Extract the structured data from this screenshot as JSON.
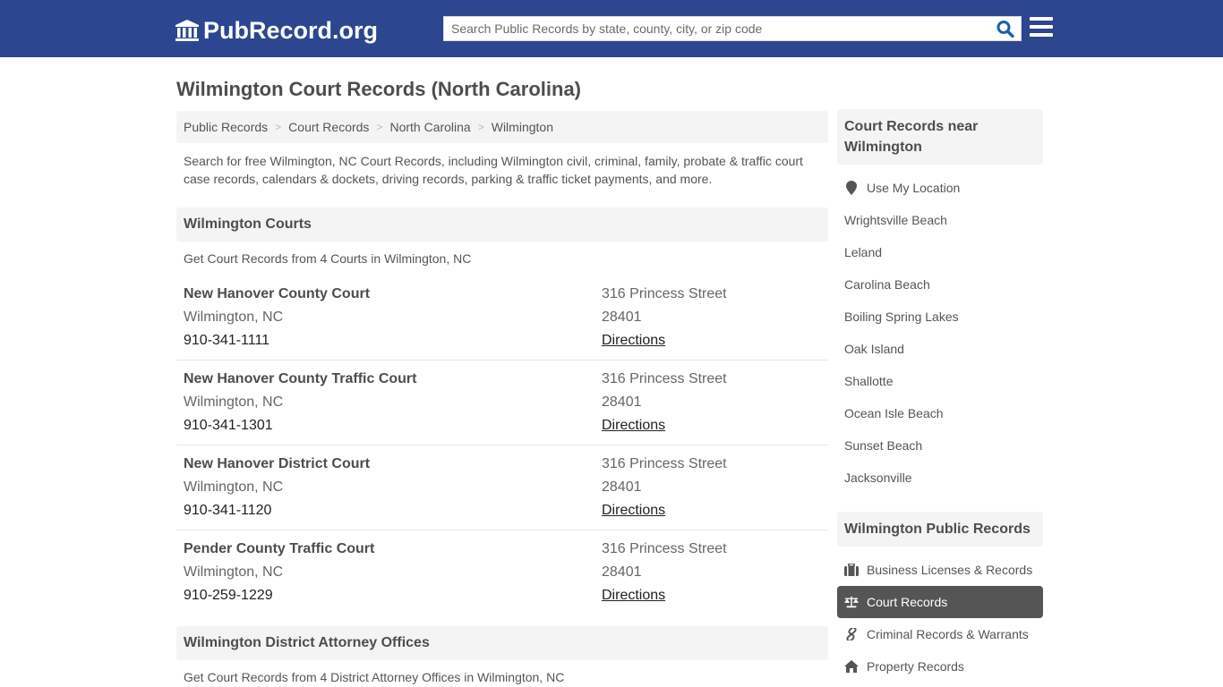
{
  "header": {
    "logo_text": "PubRecord.org",
    "logo_icon": "courthouse-icon",
    "search_placeholder": "Search Public Records by state, county, city, or zip code",
    "search_icon": "search-icon",
    "menu_icon": "hamburger-menu-icon",
    "bg_color": "#2d4690",
    "accent_color": "#1a5fa8"
  },
  "page": {
    "title": "Wilmington Court Records (North Carolina)",
    "breadcrumb": [
      "Public Records",
      "Court Records",
      "North Carolina",
      "Wilmington"
    ],
    "breadcrumb_separator": ">",
    "intro": "Search for free Wilmington, NC Court Records, including Wilmington civil, criminal, family, probate & traffic court case records, calendars & dockets, driving records, parking & traffic ticket payments, and more."
  },
  "courts_section": {
    "heading": "Wilmington Courts",
    "subheading": "Get Court Records from 4 Courts in Wilmington, NC",
    "items": [
      {
        "name": "New Hanover County Court",
        "city": "Wilmington, NC",
        "phone": "910-341-1111",
        "address": "316 Princess Street",
        "zip": "28401",
        "directions_label": "Directions"
      },
      {
        "name": "New Hanover County Traffic Court",
        "city": "Wilmington, NC",
        "phone": "910-341-1301",
        "address": "316 Princess Street",
        "zip": "28401",
        "directions_label": "Directions"
      },
      {
        "name": "New Hanover District Court",
        "city": "Wilmington, NC",
        "phone": "910-341-1120",
        "address": "316 Princess Street",
        "zip": "28401",
        "directions_label": "Directions"
      },
      {
        "name": "Pender County Traffic Court",
        "city": "Wilmington, NC",
        "phone": "910-259-1229",
        "address": "316 Princess Street",
        "zip": "28401",
        "directions_label": "Directions"
      }
    ]
  },
  "da_section": {
    "heading": "Wilmington District Attorney Offices",
    "subheading": "Get Court Records from 4 District Attorney Offices in Wilmington, NC"
  },
  "sidebar": {
    "nearby_heading": "Court Records near Wilmington",
    "use_location": {
      "label": "Use My Location",
      "icon": "map-marker-icon"
    },
    "nearby": [
      "Wrightsville Beach",
      "Leland",
      "Carolina Beach",
      "Boiling Spring Lakes",
      "Oak Island",
      "Shallotte",
      "Ocean Isle Beach",
      "Sunset Beach",
      "Jacksonville"
    ],
    "public_records_heading": "Wilmington Public Records",
    "public_records": [
      {
        "label": "Business Licenses & Records",
        "icon": "briefcase-icon",
        "active": false
      },
      {
        "label": "Court Records",
        "icon": "balance-scale-icon",
        "active": true
      },
      {
        "label": "Criminal Records & Warrants",
        "icon": "link-icon",
        "active": false
      },
      {
        "label": "Property Records",
        "icon": "home-icon",
        "active": false
      }
    ],
    "active_color": "#555555"
  }
}
